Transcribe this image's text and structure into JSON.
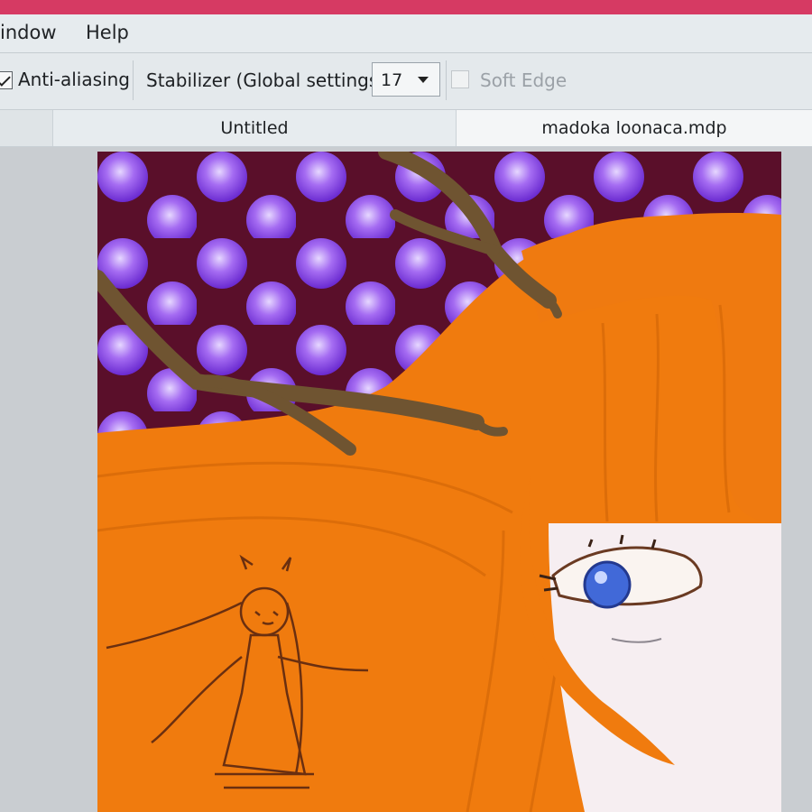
{
  "menu": {
    "window": "indow",
    "help": "Help"
  },
  "toolbar": {
    "antialiasing_label": "Anti-aliasing",
    "antialiasing_checked": true,
    "stabilizer_label": "Stabilizer (Global settings)",
    "stabilizer_value": "17",
    "soft_edge_label": "Soft Edge",
    "soft_edge_enabled": false
  },
  "tabs": [
    {
      "label": "Untitled",
      "active": false
    },
    {
      "label": "madoka loonaca.mdp",
      "active": true
    }
  ],
  "colors": {
    "accent_bar": "#d63a63",
    "hair_orange": "#f07b0e",
    "background_maroon": "#5a0f2a",
    "orb_purple": "#a56cf2",
    "eye_blue": "#4169d8",
    "antler_brown": "#6f5431"
  },
  "canvas": {
    "artwork": "digital painting: orange-haired girl with antlers, blue eye, purple orb pattern, line sketch of a small character"
  }
}
